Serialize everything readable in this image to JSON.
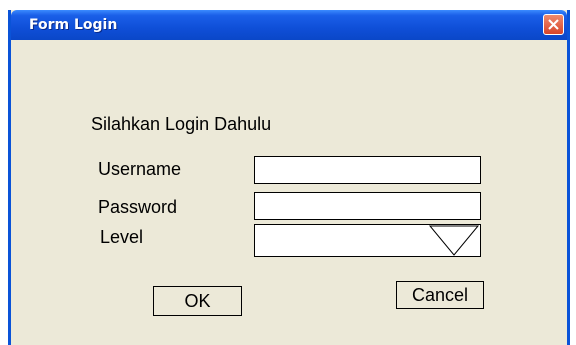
{
  "window": {
    "title": "Form Login"
  },
  "icons": {
    "close": "close-icon",
    "dropdown": "dropdown-triangle-icon"
  },
  "colors": {
    "titlebar": "#0f4fd8",
    "body": "#ece9d8",
    "close": "#d8452a"
  },
  "form": {
    "heading": "Silahkan Login Dahulu",
    "username_label": "Username",
    "username_value": "",
    "password_label": "Password",
    "password_value": "",
    "level_label": "Level",
    "level_value": ""
  },
  "buttons": {
    "ok": "OK",
    "cancel": "Cancel"
  }
}
